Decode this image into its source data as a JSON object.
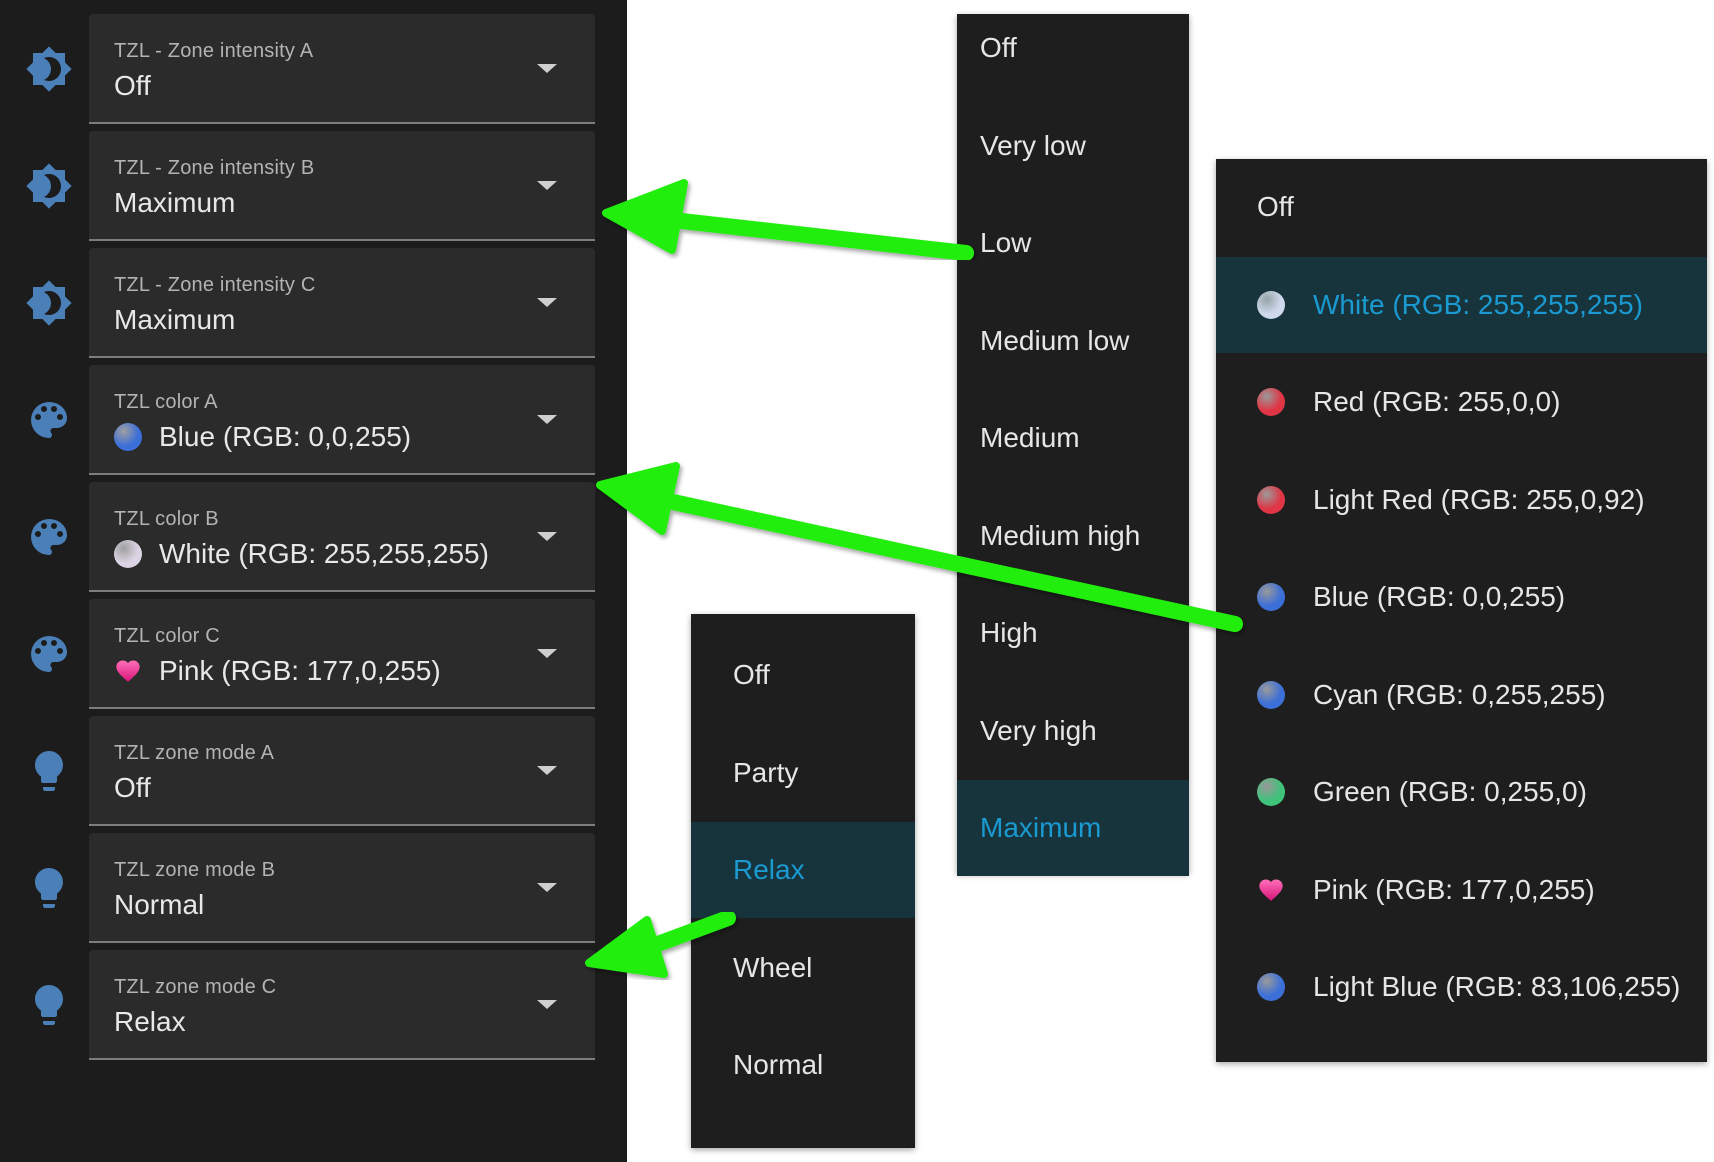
{
  "selects": [
    {
      "label": "TZL - Zone intensity A",
      "value": "Off",
      "icon": "brightness-icon"
    },
    {
      "label": "TZL - Zone intensity B",
      "value": "Maximum",
      "icon": "brightness-icon"
    },
    {
      "label": "TZL - Zone intensity C",
      "value": "Maximum",
      "icon": "brightness-icon"
    },
    {
      "label": "TZL color A",
      "value": "Blue (RGB: 0,0,255)",
      "icon": "palette-icon",
      "swatch": "#3c6fd8"
    },
    {
      "label": "TZL color B",
      "value": "White (RGB: 255,255,255)",
      "icon": "palette-icon",
      "swatch": "#dcd4e4"
    },
    {
      "label": "TZL color C",
      "value": "Pink (RGB: 177,0,255)",
      "icon": "palette-icon",
      "swatch": "heart"
    },
    {
      "label": "TZL zone mode A",
      "value": "Off",
      "icon": "lightbulb-icon"
    },
    {
      "label": "TZL zone mode B",
      "value": "Normal",
      "icon": "lightbulb-icon"
    },
    {
      "label": "TZL zone mode C",
      "value": "Relax",
      "icon": "lightbulb-icon"
    }
  ],
  "intensity_menu": {
    "items": [
      "Off",
      "Very low",
      "Low",
      "Medium low",
      "Medium",
      "Medium high",
      "High",
      "Very high",
      "Maximum"
    ],
    "selected": "Maximum"
  },
  "color_menu": {
    "items": [
      {
        "label": "Off"
      },
      {
        "label": "White (RGB: 255,255,255)",
        "swatch": "#cfd9ec"
      },
      {
        "label": "Red (RGB: 255,0,0)",
        "swatch": "#e03545"
      },
      {
        "label": "Light Red (RGB: 255,0,92)",
        "swatch": "#e03545"
      },
      {
        "label": "Blue (RGB: 0,0,255)",
        "swatch": "#3c6fd8"
      },
      {
        "label": "Cyan (RGB: 0,255,255)",
        "swatch": "#3c6fd8"
      },
      {
        "label": "Green (RGB: 0,255,0)",
        "swatch": "#3fc27a"
      },
      {
        "label": "Pink (RGB: 177,0,255)",
        "swatch": "heart"
      },
      {
        "label": "Light Blue (RGB: 83,106,255)",
        "swatch": "#3c6fd8"
      }
    ],
    "selected": "White (RGB: 255,255,255)"
  },
  "mode_menu": {
    "items": [
      "Off",
      "Party",
      "Relax",
      "Wheel",
      "Normal"
    ],
    "selected": "Relax"
  },
  "colors": {
    "icon": "#4a7fb8",
    "arrow": "#22ee11",
    "accent": "#1a9ad0",
    "selected_bg": "#17343d"
  }
}
